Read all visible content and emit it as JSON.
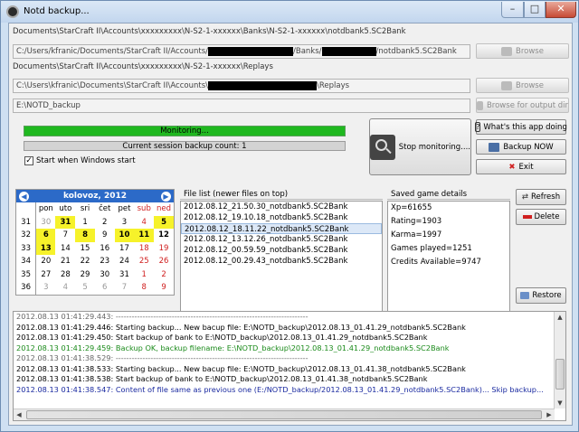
{
  "window": {
    "title": "Notd backup..."
  },
  "paths": {
    "banks_label": "Documents\\StarCraft II\\Accounts\\xxxxxxxxx\\N-S2-1-xxxxxx\\Banks\\N-S2-1-xxxxxx\\notdbank5.SC2Bank",
    "banks_prefix": "C:/Users/kfranic/Documents/StarCraft II/Accounts/",
    "banks_mid": "/Banks/",
    "banks_suffix": "/notdbank5.SC2Bank",
    "replays_label": "Documents\\StarCraft II\\Accounts\\xxxxxxxxx\\N-S2-1-xxxxxx\\Replays",
    "replays_prefix": "C:\\Users\\kfranic\\Documents\\StarCraft II\\Accounts\\",
    "replays_suffix": "\\Replays",
    "output_value": "E:\\NOTD_backup"
  },
  "buttons": {
    "browse": "Browse",
    "browse2": "Browse",
    "browse_output": "Browse for output dir",
    "stop_monitoring": "Stop monitoring....",
    "whats_this": "What's this app doing",
    "backup_now": "Backup NOW",
    "exit": "Exit",
    "refresh": "Refresh",
    "delete": "Delete",
    "restore": "Restore"
  },
  "monitor": {
    "status": "Monitoring...",
    "progress": 1.0,
    "session_count": "Current session backup count: 1",
    "start_with_windows": "Start when Windows start",
    "start_with_windows_checked": true
  },
  "calendar": {
    "month_year": "kolovoz,   2012",
    "days": [
      "pon",
      "uto",
      "sri",
      "čet",
      "pet",
      "sub",
      "ned"
    ],
    "weeks": [
      {
        "wk": "31",
        "d": [
          "30",
          "31",
          "1",
          "2",
          "3",
          "4",
          "5"
        ]
      },
      {
        "wk": "32",
        "d": [
          "6",
          "7",
          "8",
          "9",
          "10",
          "11",
          "12"
        ]
      },
      {
        "wk": "33",
        "d": [
          "13",
          "14",
          "15",
          "16",
          "17",
          "18",
          "19"
        ]
      },
      {
        "wk": "34",
        "d": [
          "20",
          "21",
          "22",
          "23",
          "24",
          "25",
          "26"
        ]
      },
      {
        "wk": "35",
        "d": [
          "27",
          "28",
          "29",
          "30",
          "31",
          "1",
          "2"
        ]
      },
      {
        "wk": "36",
        "d": [
          "3",
          "4",
          "5",
          "6",
          "7",
          "8",
          "9"
        ]
      }
    ]
  },
  "files": {
    "title": "File list (newer files on top)",
    "items": [
      "2012.08.12_21.50.30_notdbank5.SC2Bank",
      "2012.08.12_19.10.18_notdbank5.SC2Bank",
      "2012.08.12_18.11.22_notdbank5.SC2Bank",
      "2012.08.12_13.12.26_notdbank5.SC2Bank",
      "2012.08.12_00.59.59_notdbank5.SC2Bank",
      "2012.08.12_00.29.43_notdbank5.SC2Bank"
    ]
  },
  "details": {
    "title": "Saved game details",
    "lines": [
      "Xp=61655",
      "Rating=1903",
      "Karma=1997",
      "Games played=1251",
      "Credits Available=9747"
    ]
  },
  "log": {
    "lines": [
      "2012.08.13 01:41:29.443: ------------------------------------------------------------------------",
      "2012.08.13 01:41:29.446: Starting backup... New bacup file: E:\\NOTD_backup\\2012.08.13_01.41.29_notdbank5.SC2Bank",
      "2012.08.13 01:41:29.450: Start backup of bank to E:\\NOTD_backup\\2012.08.13_01.41.29_notdbank5.SC2Bank",
      "2012.08.13 01:41:29.459: Backup OK, backup filename: E:\\NOTD_backup\\2012.08.13_01.41.29_notdbank5.SC2Bank",
      "2012.08.13 01:41:38.529: ------------------------------------------------------------------------",
      "2012.08.13 01:41:38.533: Starting backup... New bacup file: E:\\NOTD_backup\\2012.08.13_01.41.38_notdbank5.SC2Bank",
      "2012.08.13 01:41:38.538: Start backup of bank to E:\\NOTD_backup\\2012.08.13_01.41.38_notdbank5.SC2Bank",
      "2012.08.13 01:41:38.547: Content of file same as previous one (E:/NOTD_backup/2012.08.13_01.41.29_notdbank5.SC2Bank)... Skip backup..."
    ]
  }
}
